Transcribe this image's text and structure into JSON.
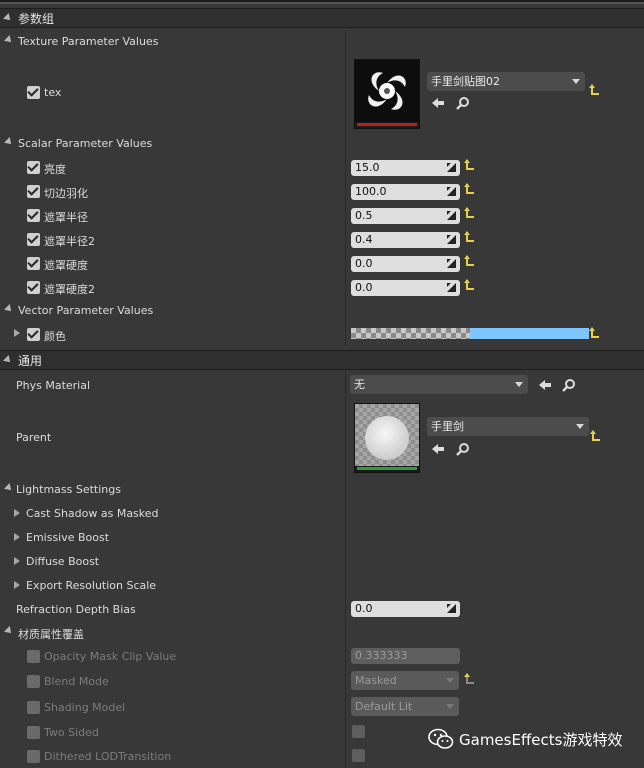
{
  "colors": {
    "reset_arrow": "#e6d24a",
    "vector_color": "#7fc5ff",
    "texture_bar": "#b42020",
    "parent_bar": "#2e9e3a"
  },
  "groups": {
    "params_title": "参数组",
    "texture": {
      "header": "Texture Parameter Values",
      "param_label": "tex",
      "asset_name": "手里剑贴图02"
    },
    "scalar": {
      "header": "Scalar Parameter Values",
      "params": [
        {
          "label": "亮度",
          "value": "15.0"
        },
        {
          "label": "切边羽化",
          "value": "100.0"
        },
        {
          "label": "遮罩半径",
          "value": "0.5"
        },
        {
          "label": "遮罩半径2",
          "value": "0.4"
        },
        {
          "label": "遮罩硬度",
          "value": "0.0"
        },
        {
          "label": "遮罩硬度2",
          "value": "0.0"
        }
      ]
    },
    "vector": {
      "header": "Vector Parameter Values",
      "param_label": "颜色"
    }
  },
  "general": {
    "title": "通用",
    "phys_material_label": "Phys Material",
    "phys_material_value": "无",
    "parent_label": "Parent",
    "parent_value": "手里剑",
    "lightmass_label": "Lightmass Settings",
    "lightmass_items": [
      "Cast Shadow as Masked",
      "Emissive Boost",
      "Diffuse Boost",
      "Export Resolution Scale"
    ],
    "refraction_label": "Refraction Depth Bias",
    "refraction_value": "0.0"
  },
  "overrides": {
    "title": "材质属性覆盖",
    "opacity_label": "Opacity Mask Clip Value",
    "opacity_value": "0.333333",
    "blend_label": "Blend Mode",
    "blend_value": "Masked",
    "shading_label": "Shading Model",
    "shading_value": "Default Lit",
    "two_sided_label": "Two Sided",
    "dithered_label": "Dithered LODTransition"
  },
  "watermark": {
    "text": "GamesEffects游戏特效"
  }
}
